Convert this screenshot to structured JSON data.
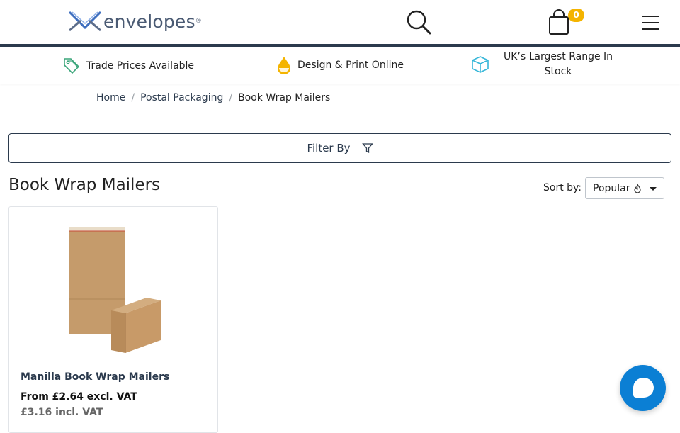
{
  "header": {
    "logo_text": "envelopes",
    "logo_mark": "®",
    "cart_count": "0",
    "icons": {
      "search": "search-icon",
      "cart": "bag-icon",
      "menu": "hamburger-icon"
    }
  },
  "usp": [
    {
      "label": "Trade Prices Available",
      "icon": "price-tag-icon"
    },
    {
      "label": "Design & Print Online",
      "icon": "ink-drop-icon"
    },
    {
      "label": "UK’s Largest Range In Stock",
      "icon": "box-icon"
    }
  ],
  "breadcrumb": {
    "items": [
      "Home",
      "Postal Packaging"
    ],
    "current": "Book Wrap Mailers",
    "separator": "/"
  },
  "filter": {
    "label": "Filter By",
    "icon": "funnel-icon"
  },
  "page_title": "Book Wrap Mailers",
  "sort": {
    "label": "Sort by:",
    "selected": "Popular",
    "selected_icon": "flame-icon"
  },
  "products": [
    {
      "name": "Manilla Book Wrap Mailers",
      "price_excl": "From £2.64 excl. VAT",
      "price_incl": "£3.16 incl. VAT"
    }
  ],
  "colors": {
    "brand_navy": "#2b3a4d",
    "badge_yellow": "#f4b400",
    "chat_blue": "#0b7fd4",
    "box_teal": "#35b6d8"
  },
  "chat": {
    "icon": "chat-bubble-icon"
  }
}
